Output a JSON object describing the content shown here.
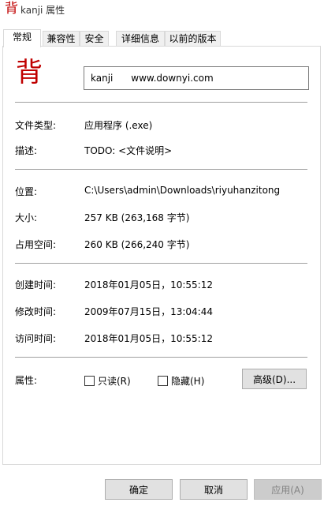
{
  "window": {
    "app_icon_glyph": "背",
    "title": "kanji 属性"
  },
  "tabs": [
    {
      "label": "常规"
    },
    {
      "label": "兼容性"
    },
    {
      "label": "安全"
    },
    {
      "label": "详细信息"
    },
    {
      "label": "以前的版本"
    }
  ],
  "general": {
    "file_icon_glyph": "背",
    "file_name": "kanji      www.downyi.com",
    "type_label": "文件类型:",
    "type_value": "应用程序 (.exe)",
    "desc_label": "描述:",
    "desc_value": "TODO: <文件说明>",
    "location_label": "位置:",
    "location_value": "C:\\Users\\admin\\Downloads\\riyuhanzitong",
    "size_label": "大小:",
    "size_value": "257 KB (263,168 字节)",
    "disk_label": "占用空间:",
    "disk_value": "260 KB (266,240 字节)",
    "created_label": "创建时间:",
    "created_value": "2018年01月05日，10:55:12",
    "modified_label": "修改时间:",
    "modified_value": "2009年07月15日，13:04:44",
    "accessed_label": "访问时间:",
    "accessed_value": "2018年01月05日，10:55:12",
    "attrs_label": "属性:",
    "readonly_label": "只读(R)",
    "hidden_label": "隐藏(H)",
    "advanced_button": "高级(D)..."
  },
  "footer": {
    "ok": "确定",
    "cancel": "取消",
    "apply": "应用(A)"
  },
  "colors": {
    "icon_red": "#c00000",
    "button_face": "#e1e1e1",
    "separator": "#a0a0a0"
  }
}
